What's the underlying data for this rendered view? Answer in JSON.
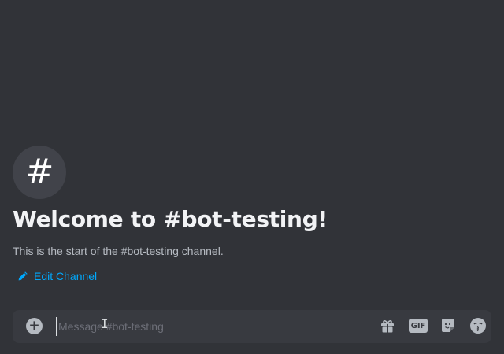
{
  "channel": {
    "icon_glyph": "#",
    "icon": "hash-icon",
    "welcome_title": "Welcome to #bot-testing!",
    "welcome_subtitle": "This is the start of the #bot-testing channel.",
    "edit_label": "Edit Channel",
    "edit_icon": "pencil-icon"
  },
  "composer": {
    "placeholder": "Message #bot-testing",
    "value": "",
    "add_icon": "plus-circle-icon",
    "add_glyph": "+",
    "tools": {
      "gift_icon": "gift-icon",
      "gif_label": "GIF",
      "sticker_icon": "sticker-icon",
      "emoji_icon": "emoji-icon"
    }
  },
  "colors": {
    "background": "#313338",
    "composer_bg": "#383a40",
    "link": "#00a8fc",
    "title": "#f2f3f5",
    "muted": "#b5bac1"
  }
}
